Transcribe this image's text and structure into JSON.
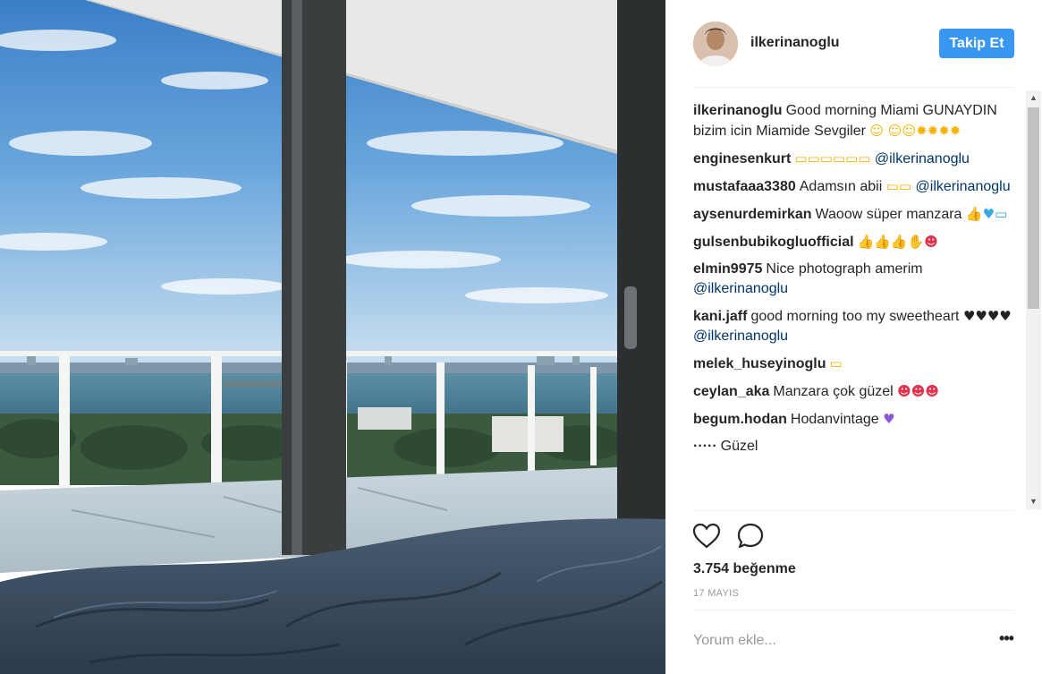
{
  "post": {
    "username": "ilkerinanoglu",
    "follow_label": "Takip Et",
    "likes": "3.754 beğenme",
    "date": "17 MAYIS",
    "comment_placeholder": "Yorum ekle...",
    "more_label": "•••"
  },
  "comments": [
    {
      "user": "ilkerinanoglu",
      "text": "Good morning Miami GUNAYDIN bizim icin Miamide Sevgiler",
      "emoji": "☺ ☺☺✹✹✹✹",
      "mention": ""
    },
    {
      "user": "enginesenkurt",
      "text": "",
      "emoji": "▭▭▭▭▭▭",
      "mention": "@ilkerinanoglu"
    },
    {
      "user": "mustafaaa3380",
      "text": "Adamsın abii",
      "emoji": "▭▭",
      "mention": "@ilkerinanoglu"
    },
    {
      "user": "aysenurdemirkan",
      "text": "Waoow süper manzara",
      "emoji": "👍♥▭",
      "mention": ""
    },
    {
      "user": "gulsenbubikogluofficial",
      "text": "",
      "emoji": "👍👍👍✋☻",
      "mention": ""
    },
    {
      "user": "elmin9975",
      "text": "Nice photograph amerim",
      "emoji": "",
      "mention": "@ilkerinanoglu"
    },
    {
      "user": "kani.jaff",
      "text": "good morning too my sweetheart",
      "emoji": "♥♥♥♥",
      "mention": "@ilkerinanoglu"
    },
    {
      "user": "melek_huseyinoglu",
      "text": "",
      "emoji": "▭",
      "mention": ""
    },
    {
      "user": "ceylan_aka",
      "text": "Manzara çok güzel",
      "emoji": "☻☻☻",
      "mention": ""
    },
    {
      "user": "begum.hodan",
      "text": "Hodanvintage",
      "emoji": "♥",
      "mention": ""
    },
    {
      "user": "·····",
      "text": "Güzel",
      "emoji": "",
      "mention": ""
    }
  ],
  "colors": {
    "accent": "#3897f0",
    "mention": "#003569",
    "text": "#262626",
    "muted": "#999999"
  },
  "icons": {
    "like": "heart-outline-icon",
    "comment": "speech-bubble-icon",
    "more": "ellipsis-icon"
  }
}
